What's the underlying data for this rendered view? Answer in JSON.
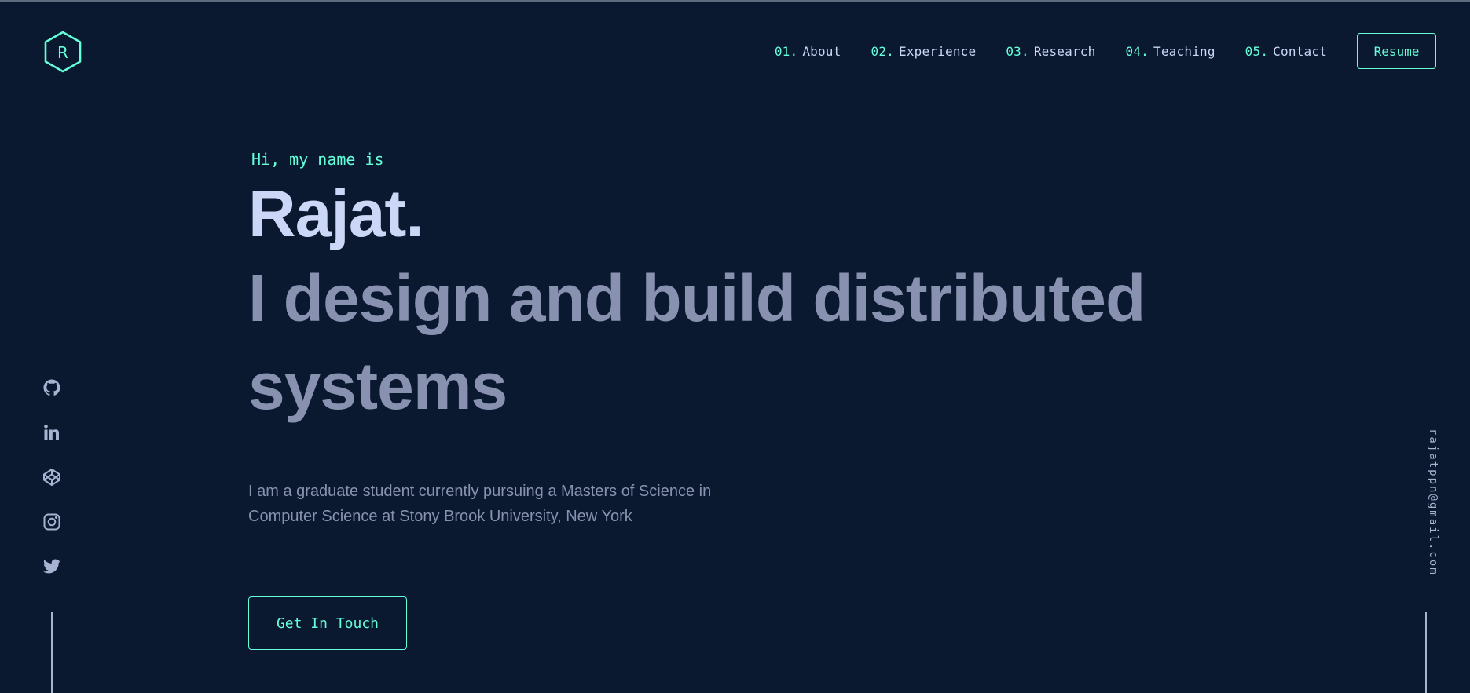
{
  "logo": {
    "letter": "R",
    "icon": "hexagon-logo-icon"
  },
  "nav": {
    "items": [
      {
        "num": "01.",
        "label": "About"
      },
      {
        "num": "02.",
        "label": "Experience"
      },
      {
        "num": "03.",
        "label": "Research"
      },
      {
        "num": "04.",
        "label": "Teaching"
      },
      {
        "num": "05.",
        "label": "Contact"
      }
    ],
    "resume_label": "Resume"
  },
  "hero": {
    "greeting": "Hi, my name is",
    "name": "Rajat.",
    "tagline": "I design and build distributed systems",
    "bio": "I am a graduate student currently pursuing a Masters of Science in Computer Science at Stony Brook University, New York",
    "cta_label": "Get In Touch"
  },
  "social": {
    "icons": [
      "github-icon",
      "linkedin-icon",
      "codepen-icon",
      "instagram-icon",
      "twitter-icon"
    ]
  },
  "email": "rajatppn@gmail.com",
  "colors": {
    "background": "#0a192f",
    "accent": "#64ffda",
    "heading": "#ccd6f6",
    "muted": "#8892b0",
    "icon": "#a8b2d1"
  }
}
